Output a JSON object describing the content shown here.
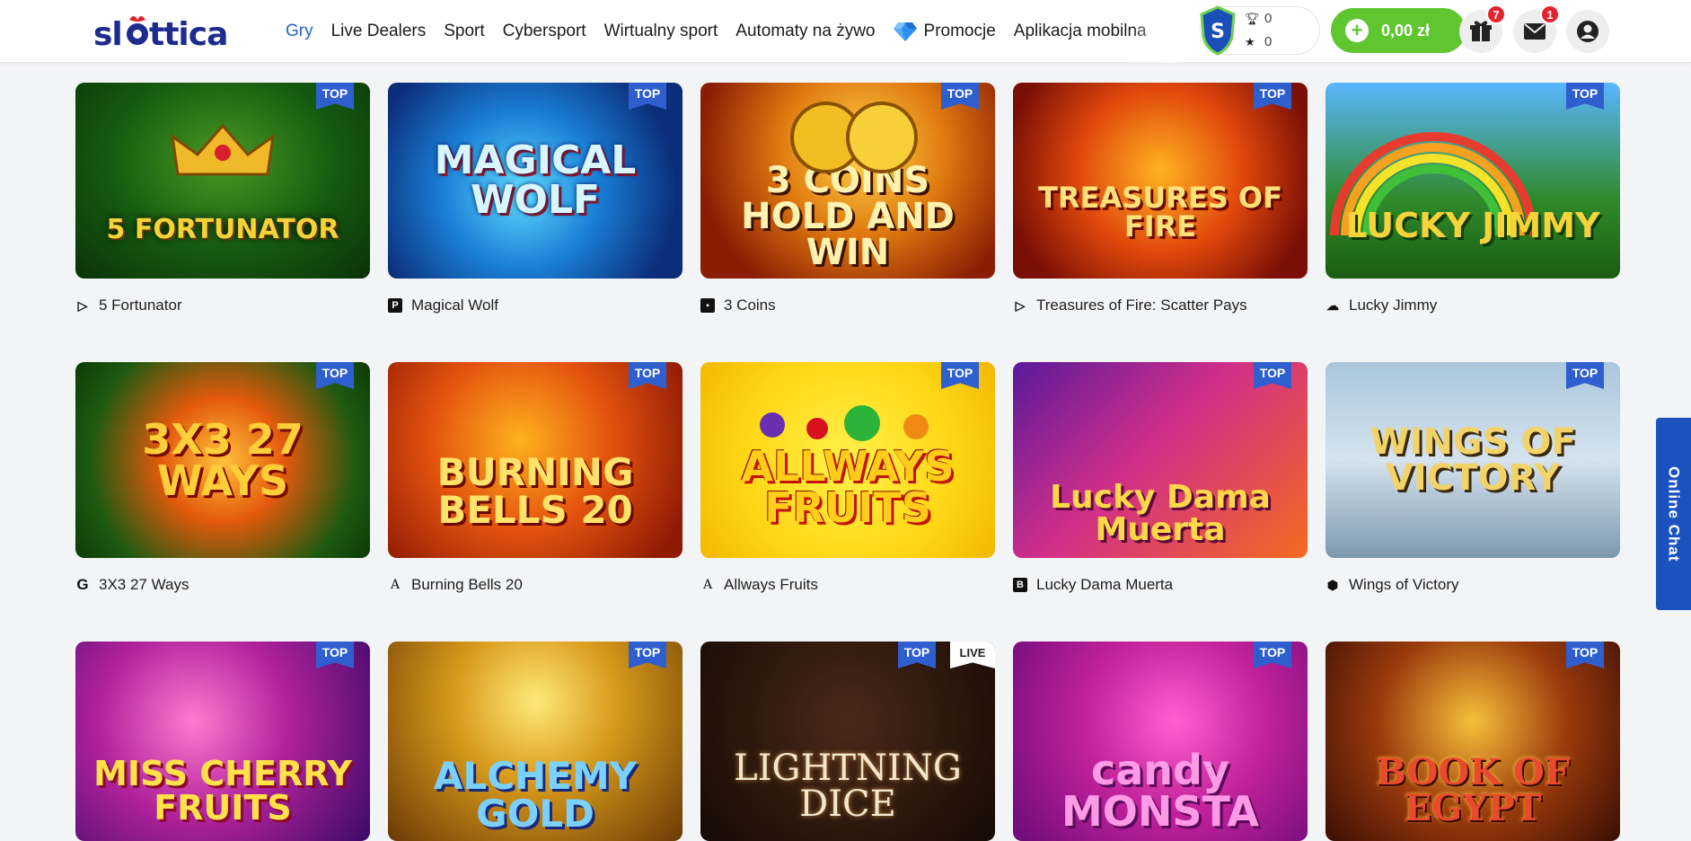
{
  "header": {
    "logo_text": "slottica",
    "nav": [
      {
        "label": "Gry",
        "active": true
      },
      {
        "label": "Live Dealers",
        "active": false
      },
      {
        "label": "Sport",
        "active": false
      },
      {
        "label": "Cybersport",
        "active": false
      },
      {
        "label": "Wirtualny sport",
        "active": false
      },
      {
        "label": "Automaty na żywo",
        "active": false
      },
      {
        "label": "Promocje",
        "active": false,
        "icon": "diamond-icon"
      },
      {
        "label": "Aplikacja mobilna",
        "active": false
      }
    ],
    "level": {
      "trophies": "0",
      "stars": "0"
    },
    "balance": "0,00 zł",
    "gifts_badge": "7",
    "messages_badge": "1"
  },
  "games": [
    {
      "title": "5 Fortunator",
      "art": "5 FORTUNATOR",
      "badge": "TOP",
      "provider_icon": "play-triangle-icon"
    },
    {
      "title": "Magical Wolf",
      "art": "MAGICAL WOLF",
      "badge": "TOP",
      "provider_icon": "p-square-icon"
    },
    {
      "title": "3 Coins",
      "art": "3 COINS HOLD AND WIN",
      "badge": "TOP",
      "provider_icon": "phone-icon"
    },
    {
      "title": "Treasures of Fire: Scatter Pays",
      "art": "TREASURES OF FIRE",
      "badge": "TOP",
      "provider_icon": "play-triangle-icon"
    },
    {
      "title": "Lucky Jimmy",
      "art": "LUCKY JIMMY",
      "badge": "TOP",
      "provider_icon": "cloud-icon"
    },
    {
      "title": "3X3 27 Ways",
      "art": "3X3 27 WAYS",
      "badge": "TOP",
      "provider_icon": "g-letter-icon"
    },
    {
      "title": "Burning Bells 20",
      "art": "BURNING BELLS 20",
      "badge": "TOP",
      "provider_icon": "a-letter-icon"
    },
    {
      "title": "Allways Fruits",
      "art": "ALLWAYS FRUITS",
      "badge": "TOP",
      "provider_icon": "a-letter-icon"
    },
    {
      "title": "Lucky Dama Muerta",
      "art": "Lucky Dama Muerta",
      "badge": "TOP",
      "provider_icon": "b-square-icon"
    },
    {
      "title": "Wings of Victory",
      "art": "WINGS OF VICTORY",
      "badge": "TOP",
      "provider_icon": "pin-icon"
    },
    {
      "title": "",
      "art": "MISS CHERRY FRUITS",
      "badge": "TOP",
      "provider_icon": ""
    },
    {
      "title": "",
      "art": "ALCHEMY GOLD",
      "badge": "TOP",
      "provider_icon": ""
    },
    {
      "title": "",
      "art": "LIGHTNING DICE",
      "badge": "TOP",
      "badge2": "LIVE",
      "provider_icon": ""
    },
    {
      "title": "",
      "art": "candy MONSTA",
      "badge": "TOP",
      "provider_icon": ""
    },
    {
      "title": "",
      "art": "BOOK OF EGYPT",
      "badge": "TOP",
      "provider_icon": ""
    }
  ],
  "online_chat": "Online Chat",
  "colors": {
    "accent": "#2366d1",
    "balance_green": "#5fc62f",
    "top_badge": "#2f5fcf",
    "chat": "#1b52bd",
    "badge_red": "#e3232e"
  }
}
